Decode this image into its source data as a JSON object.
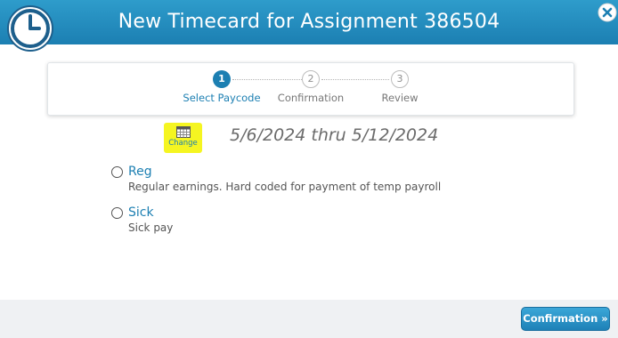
{
  "dialog": {
    "title": "New Timecard for Assignment 386504",
    "close_icon": "close-icon"
  },
  "stepper": {
    "steps": [
      {
        "number": "1",
        "label": "Select Paycode",
        "state": "active"
      },
      {
        "number": "2",
        "label": "Confirmation",
        "state": "inactive"
      },
      {
        "number": "3",
        "label": "Review",
        "state": "inactive"
      }
    ]
  },
  "period": {
    "change_label": "Change",
    "date_range": "5/6/2024 thru 5/12/2024"
  },
  "paycodes": [
    {
      "name": "Reg",
      "description": "Regular earnings. Hard coded for payment of temp payroll",
      "selected": false
    },
    {
      "name": "Sick",
      "description": "Sick pay",
      "selected": false
    }
  ],
  "footer": {
    "next_button_label": "Confirmation »"
  },
  "colors": {
    "accent": "#1c7fb2",
    "highlight": "#f5f521",
    "footer_bg": "#eff1f3"
  }
}
